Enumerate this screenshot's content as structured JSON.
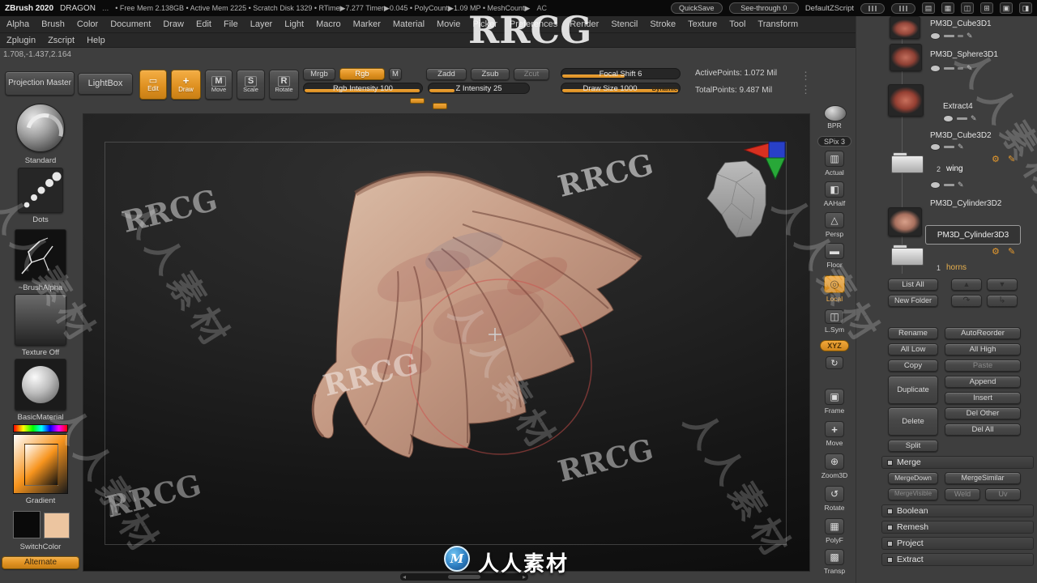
{
  "watermarks": {
    "brand": "RRCG",
    "cn": "人人素材"
  },
  "footer": {
    "brand_cn": "人人素材"
  },
  "title_bar": {
    "app": "ZBrush 2020",
    "doc": "DRAGON",
    "dots": "...",
    "stats": "• Free Mem 2.138GB • Active Mem 2225 • Scratch Disk 1329 • RTime▶7.277 Timer▶0.045 • PolyCount▶1.09 MP • MeshCount▶",
    "ac": "AC",
    "quicksave": "QuickSave",
    "seethrough": "See-through 0",
    "zscript": "DefaultZScript"
  },
  "menus": {
    "row1": [
      "Alpha",
      "Brush",
      "Color",
      "Document",
      "Draw",
      "Edit",
      "File",
      "Layer",
      "Light",
      "Macro",
      "Marker",
      "Material",
      "Movie",
      "Picker",
      "Preferences",
      "Render",
      "Stencil",
      "Stroke",
      "Texture",
      "Tool",
      "Transform"
    ],
    "row2": [
      "Zplugin",
      "Zscript",
      "Help"
    ],
    "coords": "1.708,-1.437,2.164"
  },
  "toolbar": {
    "lightbox": "LightBox",
    "edit": "Edit",
    "draw": "Draw",
    "move": "Move",
    "scale": "Scale",
    "rotate": "Rotate",
    "mrgb": "Mrgb",
    "rgb": "Rgb",
    "m": "M",
    "rgb_intensity": "Rgb Intensity 100",
    "zadd": "Zadd",
    "zsub": "Zsub",
    "zcut": "Zcut",
    "z_intensity": "Z Intensity 25",
    "focal_shift": "Focal Shift 6",
    "draw_size": "Draw Size 1000",
    "dynamic": "Dynamic",
    "active_points": "ActivePoints: 1.072 Mil",
    "total_points": "TotalPoints: 9.487 Mil"
  },
  "left_panel": {
    "projection_master": "Projection Master",
    "standard": "Standard",
    "dots": "Dots",
    "brush_alpha": "~BrushAlpha",
    "texture_off": "Texture Off",
    "basic_material": "BasicMaterial",
    "gradient": "Gradient",
    "switch_color": "SwitchColor",
    "alternate": "Alternate"
  },
  "right_toolbar": {
    "bpr": "BPR",
    "spix": "SPix 3",
    "actual": "Actual",
    "aahalf": "AAHalf",
    "persp": "Persp",
    "floor": "Floor",
    "local": "Local",
    "lsym": "L.Sym",
    "xyz": "XYZ",
    "frame": "Frame",
    "move": "Move",
    "zoom3d": "Zoom3D",
    "rotate": "Rotate",
    "polyf": "PolyF",
    "transp": "Transp"
  },
  "subtool": {
    "items": [
      {
        "name": "PM3D_Cube3D1"
      },
      {
        "name": "PM3D_Sphere3D1"
      },
      {
        "name": "Extract4"
      },
      {
        "name": "PM3D_Cube3D2"
      },
      {
        "name": "wing",
        "count": "2"
      },
      {
        "name": "PM3D_Cylinder3D2"
      },
      {
        "name": "PM3D_Cylinder3D3"
      },
      {
        "name": "horns",
        "count": "1"
      }
    ],
    "list_all": "List All",
    "new_folder": "New Folder",
    "rename": "Rename",
    "autoreorder": "AutoReorder",
    "all_low": "All Low",
    "all_high": "All High",
    "copy": "Copy",
    "paste": "Paste",
    "duplicate": "Duplicate",
    "append": "Append",
    "insert": "Insert",
    "delete": "Delete",
    "del_other": "Del Other",
    "del_all": "Del All",
    "split": "Split",
    "merge": "Merge",
    "merge_down": "MergeDown",
    "merge_similar": "MergeSimilar",
    "merge_visible": "MergeVisible",
    "weld": "Weld",
    "uv": "Uv",
    "boolean": "Boolean",
    "remesh": "Remesh",
    "project": "Project",
    "extract": "Extract"
  },
  "glyphs": {
    "up": "▲",
    "down": "▼",
    "out": "↷",
    "into": "↳",
    "gear": "⚙",
    "pen": "✎",
    "edit": "▭",
    "draw": "+",
    "move": "M",
    "scale": "S",
    "rotate": "R",
    "actual": "▥",
    "aahalf": "◧",
    "persp": "△",
    "floor": "▬",
    "local": "◎",
    "lsym": "◫",
    "cycle": "↻",
    "frame": "▣",
    "move3d": "+",
    "zoom3d": "⊕",
    "rotate3d": "↺",
    "polyf": "▦",
    "transp": "▩",
    "left": "◂",
    "right": "▸",
    "grip": "⋮",
    "m_letter": "M",
    "t1": "▤",
    "t2": "▦",
    "t3": "◫",
    "t4": "⊞",
    "t5": "▣",
    "t6": "◨"
  },
  "colors": {
    "accent": "#e6992e"
  }
}
